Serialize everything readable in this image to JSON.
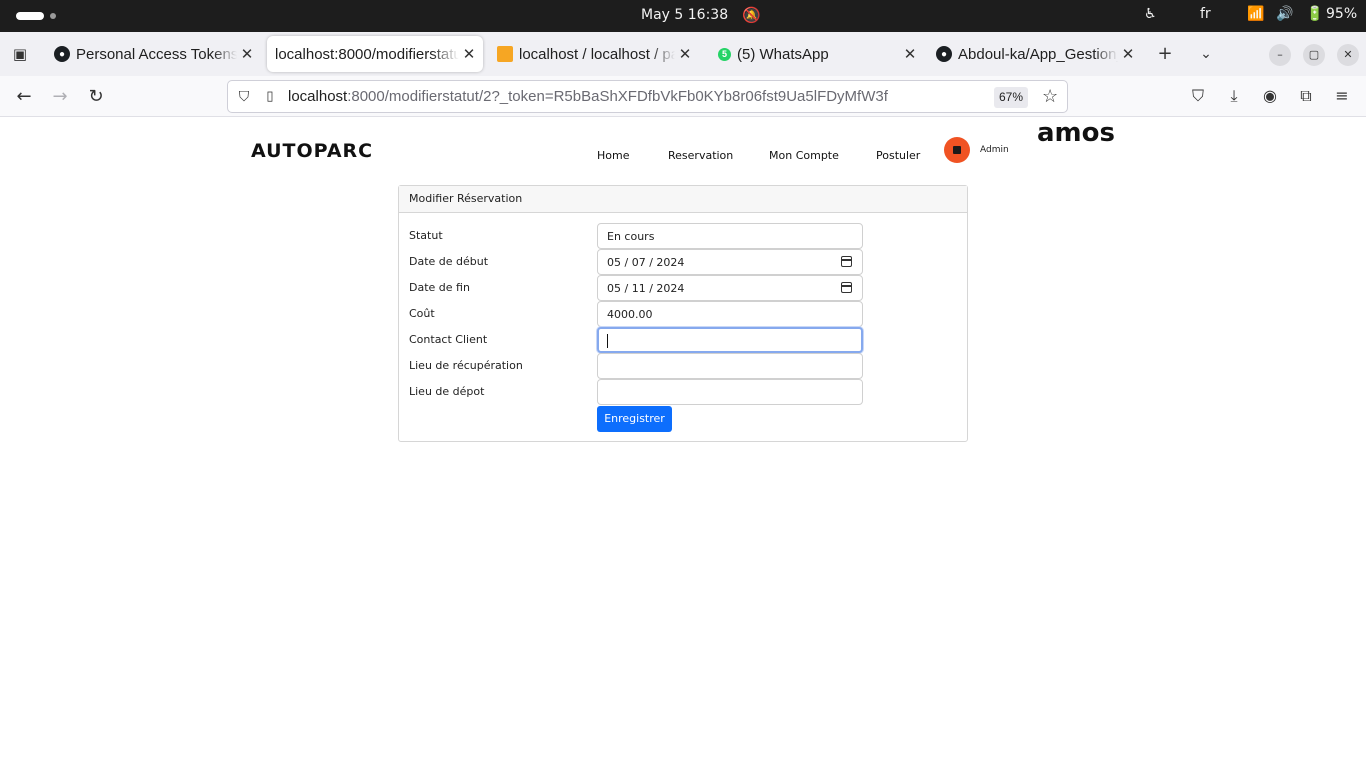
{
  "system_bar": {
    "clock": "May 5  16:38",
    "language": "fr",
    "battery": "95%"
  },
  "browser": {
    "tabs": [
      {
        "title": "Personal Access Tokens (",
        "favicon": "github-icon"
      },
      {
        "title": "localhost:8000/modifierstatut",
        "favicon": "none"
      },
      {
        "title": "localhost / localhost / pa",
        "favicon": "phpmyadmin-icon"
      },
      {
        "title": "(5) WhatsApp",
        "favicon": "whatsapp-icon"
      },
      {
        "title": "Abdoul-ka/App_Gestion_",
        "favicon": "github-icon"
      }
    ],
    "url_host": "localhost",
    "url_rest": ":8000/modifierstatut/2?_token=R5bBaShXFDfbVkFb0KYb8r06fst9Ua5lFDyMfW3f",
    "zoom": "67%",
    "whatsapp_badge": "5"
  },
  "site": {
    "brand": "AUTOPARC",
    "menu": [
      "Home",
      "Reservation",
      "Mon Compte",
      "Postuler"
    ],
    "admin_label": "Admin",
    "user_name": "amos"
  },
  "form": {
    "title": "Modifier Réservation",
    "fields": [
      {
        "label": "Statut",
        "value": ""
      },
      {
        "label": "Date de début",
        "value": "05 / 07 / 2024"
      },
      {
        "label": "Date de fin",
        "value": "05 / 11 / 2024"
      },
      {
        "label": "Coût",
        "value": "4000.00"
      },
      {
        "label": "Contact Client",
        "value": ""
      },
      {
        "label": "Lieu de récupération",
        "value": ""
      },
      {
        "label": "Lieu de dépot",
        "value": ""
      }
    ],
    "statut_value": "En cours",
    "submit_label": "Enregistrer"
  },
  "colors": {
    "accent_button": "#0d6efd",
    "avatar": "#f05323"
  }
}
